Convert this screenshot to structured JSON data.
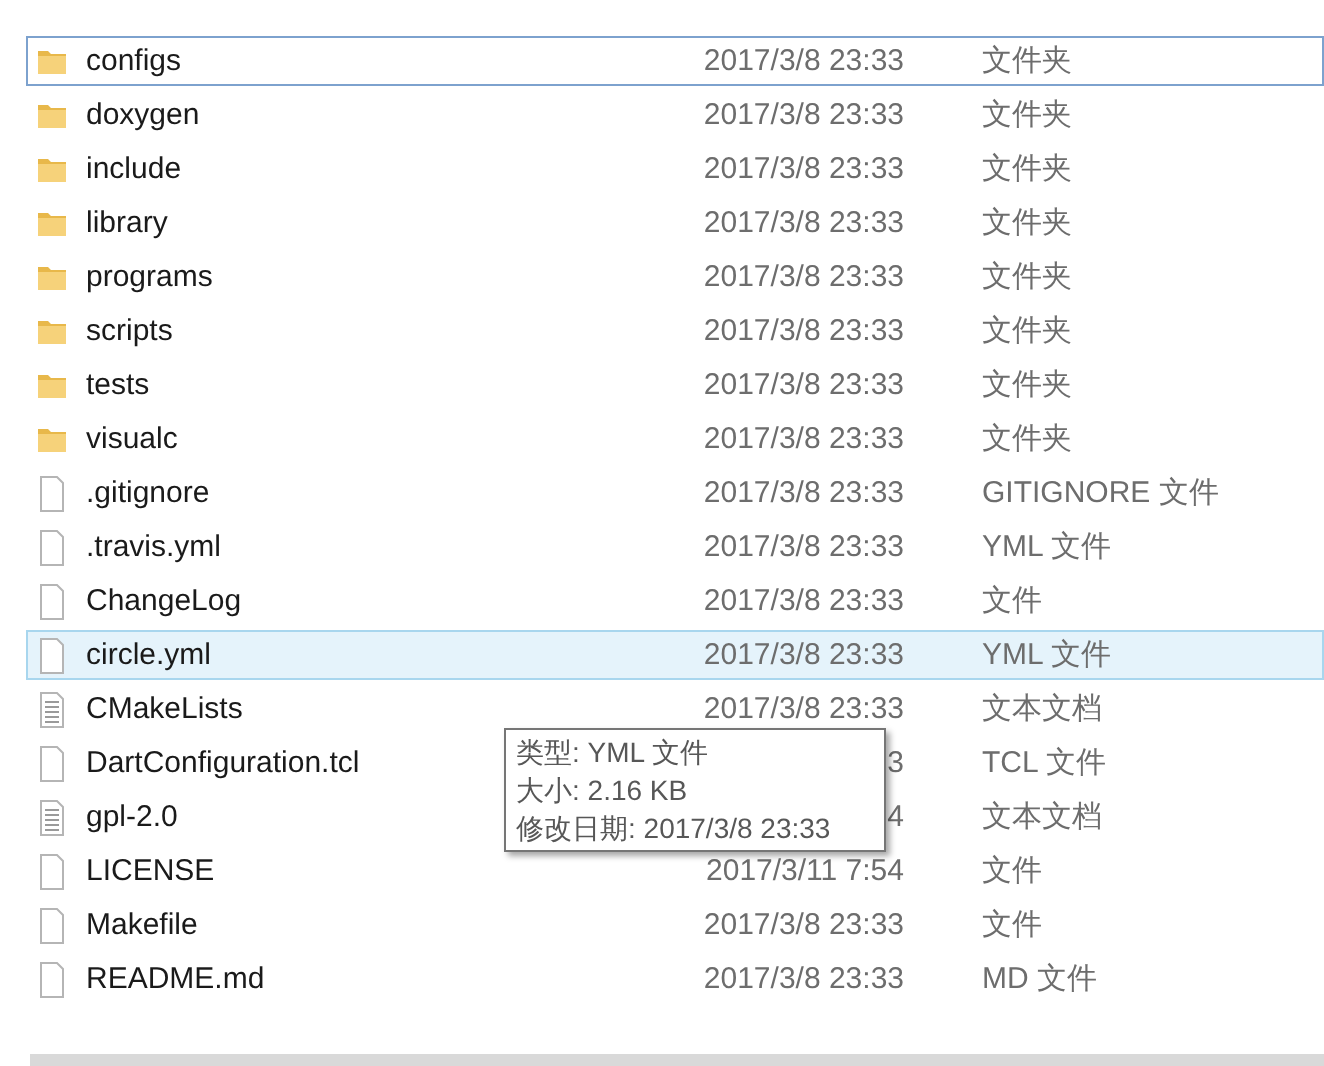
{
  "files": [
    {
      "name": "configs",
      "kind": "folder",
      "date": "2017/3/8 23:33",
      "type": "文件夹",
      "focused": true,
      "hovered": false
    },
    {
      "name": "doxygen",
      "kind": "folder",
      "date": "2017/3/8 23:33",
      "type": "文件夹",
      "focused": false,
      "hovered": false
    },
    {
      "name": "include",
      "kind": "folder",
      "date": "2017/3/8 23:33",
      "type": "文件夹",
      "focused": false,
      "hovered": false
    },
    {
      "name": "library",
      "kind": "folder",
      "date": "2017/3/8 23:33",
      "type": "文件夹",
      "focused": false,
      "hovered": false
    },
    {
      "name": "programs",
      "kind": "folder",
      "date": "2017/3/8 23:33",
      "type": "文件夹",
      "focused": false,
      "hovered": false
    },
    {
      "name": "scripts",
      "kind": "folder",
      "date": "2017/3/8 23:33",
      "type": "文件夹",
      "focused": false,
      "hovered": false
    },
    {
      "name": "tests",
      "kind": "folder",
      "date": "2017/3/8 23:33",
      "type": "文件夹",
      "focused": false,
      "hovered": false
    },
    {
      "name": "visualc",
      "kind": "folder",
      "date": "2017/3/8 23:33",
      "type": "文件夹",
      "focused": false,
      "hovered": false
    },
    {
      "name": ".gitignore",
      "kind": "file",
      "date": "2017/3/8 23:33",
      "type": "GITIGNORE 文件",
      "focused": false,
      "hovered": false
    },
    {
      "name": ".travis.yml",
      "kind": "file",
      "date": "2017/3/8 23:33",
      "type": "YML 文件",
      "focused": false,
      "hovered": false
    },
    {
      "name": "ChangeLog",
      "kind": "file",
      "date": "2017/3/8 23:33",
      "type": "文件",
      "focused": false,
      "hovered": false
    },
    {
      "name": "circle.yml",
      "kind": "file",
      "date": "2017/3/8 23:33",
      "type": "YML 文件",
      "focused": false,
      "hovered": true
    },
    {
      "name": "CMakeLists",
      "kind": "text",
      "date": "2017/3/8 23:33",
      "type": "文本文档",
      "focused": false,
      "hovered": false
    },
    {
      "name": "DartConfiguration.tcl",
      "kind": "file",
      "date": "3",
      "type": "TCL 文件",
      "focused": false,
      "hovered": false
    },
    {
      "name": "gpl-2.0",
      "kind": "text",
      "date": "4",
      "type": "文本文档",
      "focused": false,
      "hovered": false
    },
    {
      "name": "LICENSE",
      "kind": "file",
      "date": "2017/3/11 7:54",
      "type": "文件",
      "focused": false,
      "hovered": false
    },
    {
      "name": "Makefile",
      "kind": "file",
      "date": "2017/3/8 23:33",
      "type": "文件",
      "focused": false,
      "hovered": false
    },
    {
      "name": "README.md",
      "kind": "file",
      "date": "2017/3/8 23:33",
      "type": "MD 文件",
      "focused": false,
      "hovered": false
    }
  ],
  "tooltip": {
    "lines": [
      "类型: YML 文件",
      "大小: 2.16 KB",
      "修改日期: 2017/3/8 23:33"
    ]
  }
}
